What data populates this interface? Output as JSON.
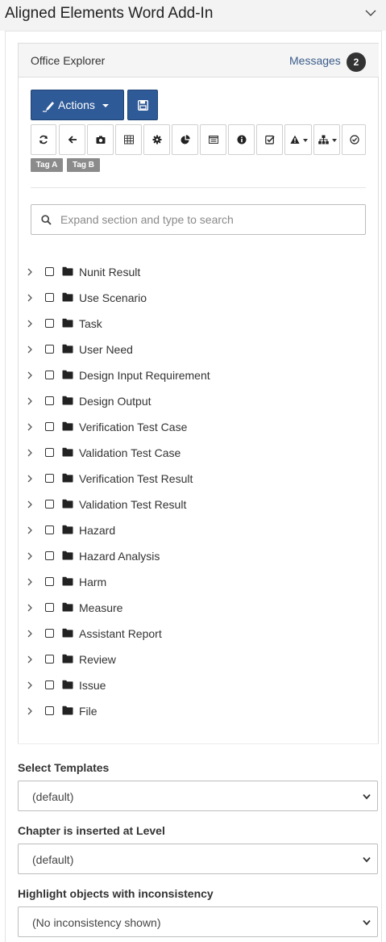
{
  "taskpane": {
    "title": "Aligned Elements Word Add-In"
  },
  "panel": {
    "title": "Office Explorer",
    "messages_label": "Messages",
    "messages_count": "2"
  },
  "toolbar": {
    "actions_label": "Actions",
    "icons": [
      "refresh-icon",
      "back-arrow-icon",
      "camera-icon",
      "table-icon",
      "gear-icon",
      "pie-chart-icon",
      "list-box-icon",
      "info-icon",
      "checkbox-icon",
      "warning-dropdown-icon",
      "hierarchy-dropdown-icon",
      "check-circle-icon"
    ]
  },
  "tags": [
    "Tag A",
    "Tag B"
  ],
  "search": {
    "placeholder": "Expand section and type to search"
  },
  "tree": {
    "items": [
      "Nunit Result",
      "Use Scenario",
      "Task",
      "User Need",
      "Design Input Requirement",
      "Design Output",
      "Verification Test Case",
      "Validation Test Case",
      "Verification Test Result",
      "Validation Test Result",
      "Hazard",
      "Hazard Analysis",
      "Harm",
      "Measure",
      "Assistant Report",
      "Review",
      "Issue",
      "File"
    ]
  },
  "settings": {
    "templates_label": "Select Templates",
    "templates_value": "(default)",
    "chapter_label": "Chapter is inserted at Level",
    "chapter_value": "(default)",
    "highlight_label": "Highlight objects with inconsistency",
    "highlight_value": "(No inconsistency shown)"
  },
  "colors": {
    "primary": "#2e5a97",
    "badge": "#333333",
    "tag": "#8b8b8b",
    "link": "#3b5d8a"
  }
}
